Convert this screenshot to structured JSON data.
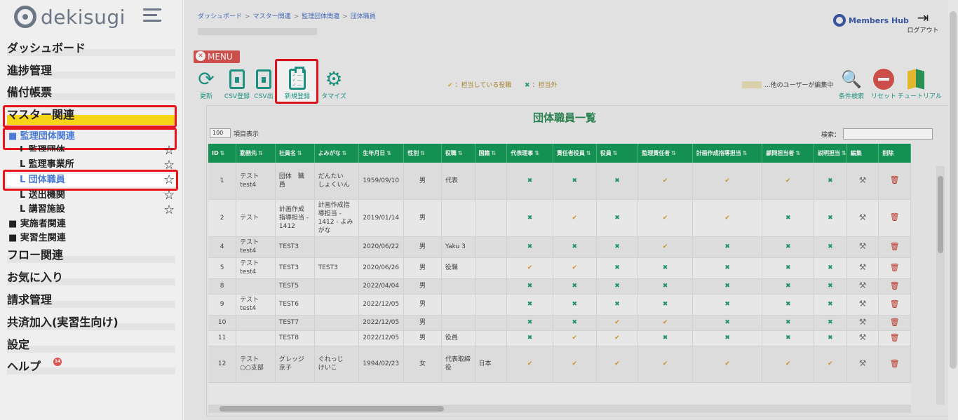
{
  "sidebar": {
    "logo_text": "dekisugi",
    "nav": [
      {
        "label": "ダッシュボード"
      },
      {
        "label": "進捗管理"
      },
      {
        "label": "備付帳票"
      },
      {
        "label": "マスター関連"
      },
      {
        "label": "フロー関連"
      },
      {
        "label": "お気に入り"
      },
      {
        "label": "請求管理"
      },
      {
        "label": "共済加入(実習生向け)"
      },
      {
        "label": "設定"
      },
      {
        "label": "ヘルプ",
        "badge": "14"
      }
    ],
    "sub": {
      "kanri": "■ 監理団体関連",
      "kanri_dantai": "L 監理団体",
      "kanri_jigyo": "L 監理事業所",
      "dantai_shokuin": "L 団体職員",
      "soushutsu": "L 送出機関",
      "koushu": "L 講習施設",
      "jisshisha": "■ 実施者関連",
      "jisshusei": "■ 実習生関連"
    }
  },
  "header": {
    "breadcrumb": [
      "ダッシュボード",
      "マスター関連",
      "監理団体関連",
      "団体職員"
    ],
    "members_hub": "Members Hub",
    "logout_label": "ログアウト"
  },
  "toolbar": {
    "menu_label": "MENU",
    "refresh": "更新",
    "csv_import": "CSV登録",
    "csv_export": "CSV出",
    "new_register": "新規登録",
    "customize": "タマイズ",
    "legend_check": "：担当している役職",
    "legend_x": "：担当外",
    "legend_other": "...他のユーザーが編集中",
    "search_cond": "条件検索",
    "reset": "リセット",
    "tutorial": "チュートリアル"
  },
  "panel": {
    "title": "団体職員一覧",
    "page_length": "100",
    "page_length_label": "項目表示",
    "search_label": "検索："
  },
  "table": {
    "headers": [
      "ID",
      "勤務先",
      "社員名",
      "よみがな",
      "生年月日",
      "性別",
      "役職",
      "国籍",
      "代表理事",
      "責任者役員",
      "役員",
      "監理責任者",
      "計画作成指導担当",
      "顧問担当者",
      "説明担当",
      "編集",
      "削除"
    ],
    "rows": [
      {
        "id": "1",
        "office": "テスト test4",
        "name": "団体　職員",
        "kana": "だんたい　しょくいん",
        "dob": "1959/09/10",
        "sex": "男",
        "title": "代表",
        "nation": "",
        "marks": [
          "x",
          "x",
          "x",
          "v",
          "v",
          "v",
          "x"
        ]
      },
      {
        "id": "2",
        "office": "テスト",
        "name": "計画作成指導担当 - 1412",
        "kana": "計画作成指導担当 - 1412 - よみがな",
        "dob": "2019/01/14",
        "sex": "男",
        "title": "",
        "nation": "",
        "marks": [
          "x",
          "v",
          "x",
          "v",
          "v",
          "x",
          "x"
        ]
      },
      {
        "id": "4",
        "office": "テスト test4",
        "name": "TEST3",
        "kana": "",
        "dob": "2020/06/22",
        "sex": "男",
        "title": "Yaku 3",
        "nation": "",
        "marks": [
          "x",
          "x",
          "x",
          "v",
          "x",
          "x",
          "x"
        ]
      },
      {
        "id": "5",
        "office": "テスト test4",
        "name": "TEST3",
        "kana": "TEST3",
        "dob": "2020/06/26",
        "sex": "男",
        "title": "役職",
        "nation": "",
        "marks": [
          "v",
          "v",
          "x",
          "x",
          "x",
          "x",
          "x"
        ]
      },
      {
        "id": "8",
        "office": "",
        "name": "TEST5",
        "kana": "",
        "dob": "2022/04/04",
        "sex": "男",
        "title": "",
        "nation": "",
        "marks": [
          "x",
          "x",
          "x",
          "x",
          "x",
          "x",
          "x"
        ]
      },
      {
        "id": "9",
        "office": "テスト test4",
        "name": "TEST6",
        "kana": "",
        "dob": "2022/12/05",
        "sex": "男",
        "title": "",
        "nation": "",
        "marks": [
          "x",
          "x",
          "x",
          "x",
          "x",
          "x",
          "x"
        ]
      },
      {
        "id": "10",
        "office": "",
        "name": "TEST7",
        "kana": "",
        "dob": "2022/12/05",
        "sex": "男",
        "title": "",
        "nation": "",
        "marks": [
          "x",
          "x",
          "v",
          "v",
          "x",
          "x",
          "x"
        ]
      },
      {
        "id": "11",
        "office": "",
        "name": "TEST8",
        "kana": "",
        "dob": "2022/12/05",
        "sex": "男",
        "title": "役員",
        "nation": "",
        "marks": [
          "x",
          "v",
          "v",
          "x",
          "x",
          "x",
          "x"
        ]
      },
      {
        "id": "12",
        "office": "テスト ○○支部",
        "name": "グレッジ 京子",
        "kana": "ぐれっじ　けいこ",
        "dob": "1994/02/23",
        "sex": "女",
        "title": "代表取締役",
        "nation": "日本",
        "marks": [
          "v",
          "v",
          "v",
          "v",
          "v",
          "v",
          "v"
        ]
      }
    ]
  },
  "colors": {
    "accent_green": "#159a58",
    "teal_icon": "#1f9a88",
    "check": "#d99a2b",
    "cross": "#1e9b78",
    "highlight": "#e8141b",
    "active_nav": "#f6d417"
  }
}
